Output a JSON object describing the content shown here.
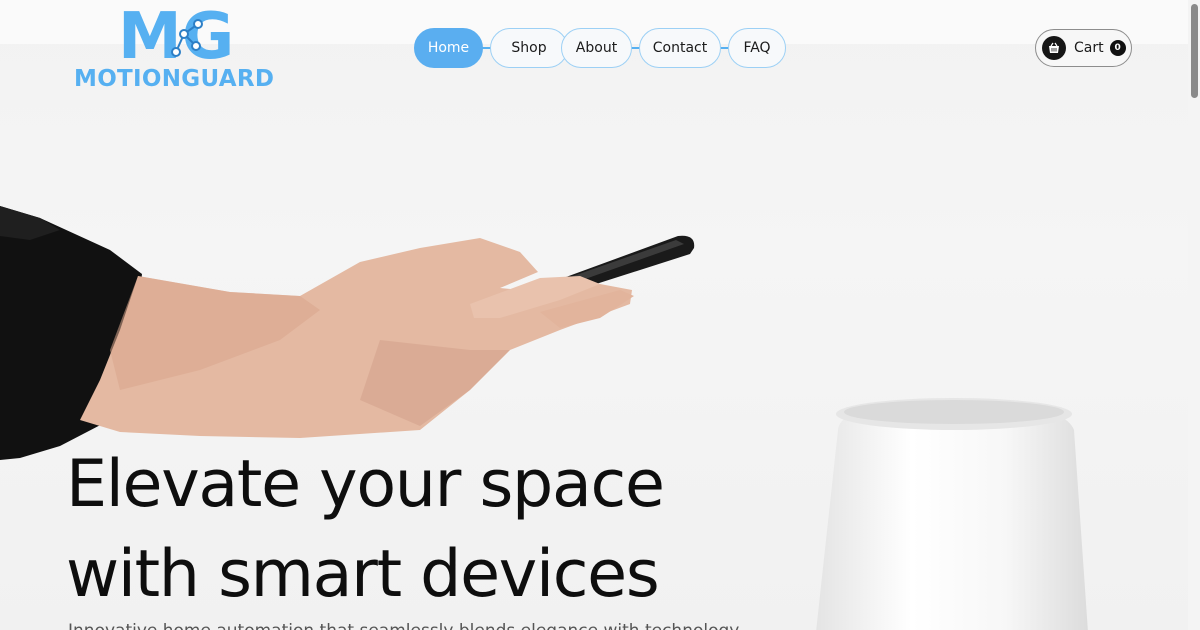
{
  "brand": {
    "logo_letters": "MG",
    "name": "MOTIONGUARD",
    "color": "#56b0f1"
  },
  "nav": {
    "items": [
      {
        "label": "Home",
        "active": true
      },
      {
        "label": "Shop",
        "active": false
      },
      {
        "label": "About",
        "active": false
      },
      {
        "label": "Contact",
        "active": false
      },
      {
        "label": "FAQ",
        "active": false
      }
    ],
    "accent": "#56b0f1"
  },
  "cart": {
    "label": "Cart",
    "count": "0",
    "icon": "shopping-basket-icon"
  },
  "hero": {
    "title_line1": "Elevate your space",
    "title_line2": "with smart devices",
    "subtitle": "Innovative home automation that seamlessly blends elegance with technology"
  }
}
